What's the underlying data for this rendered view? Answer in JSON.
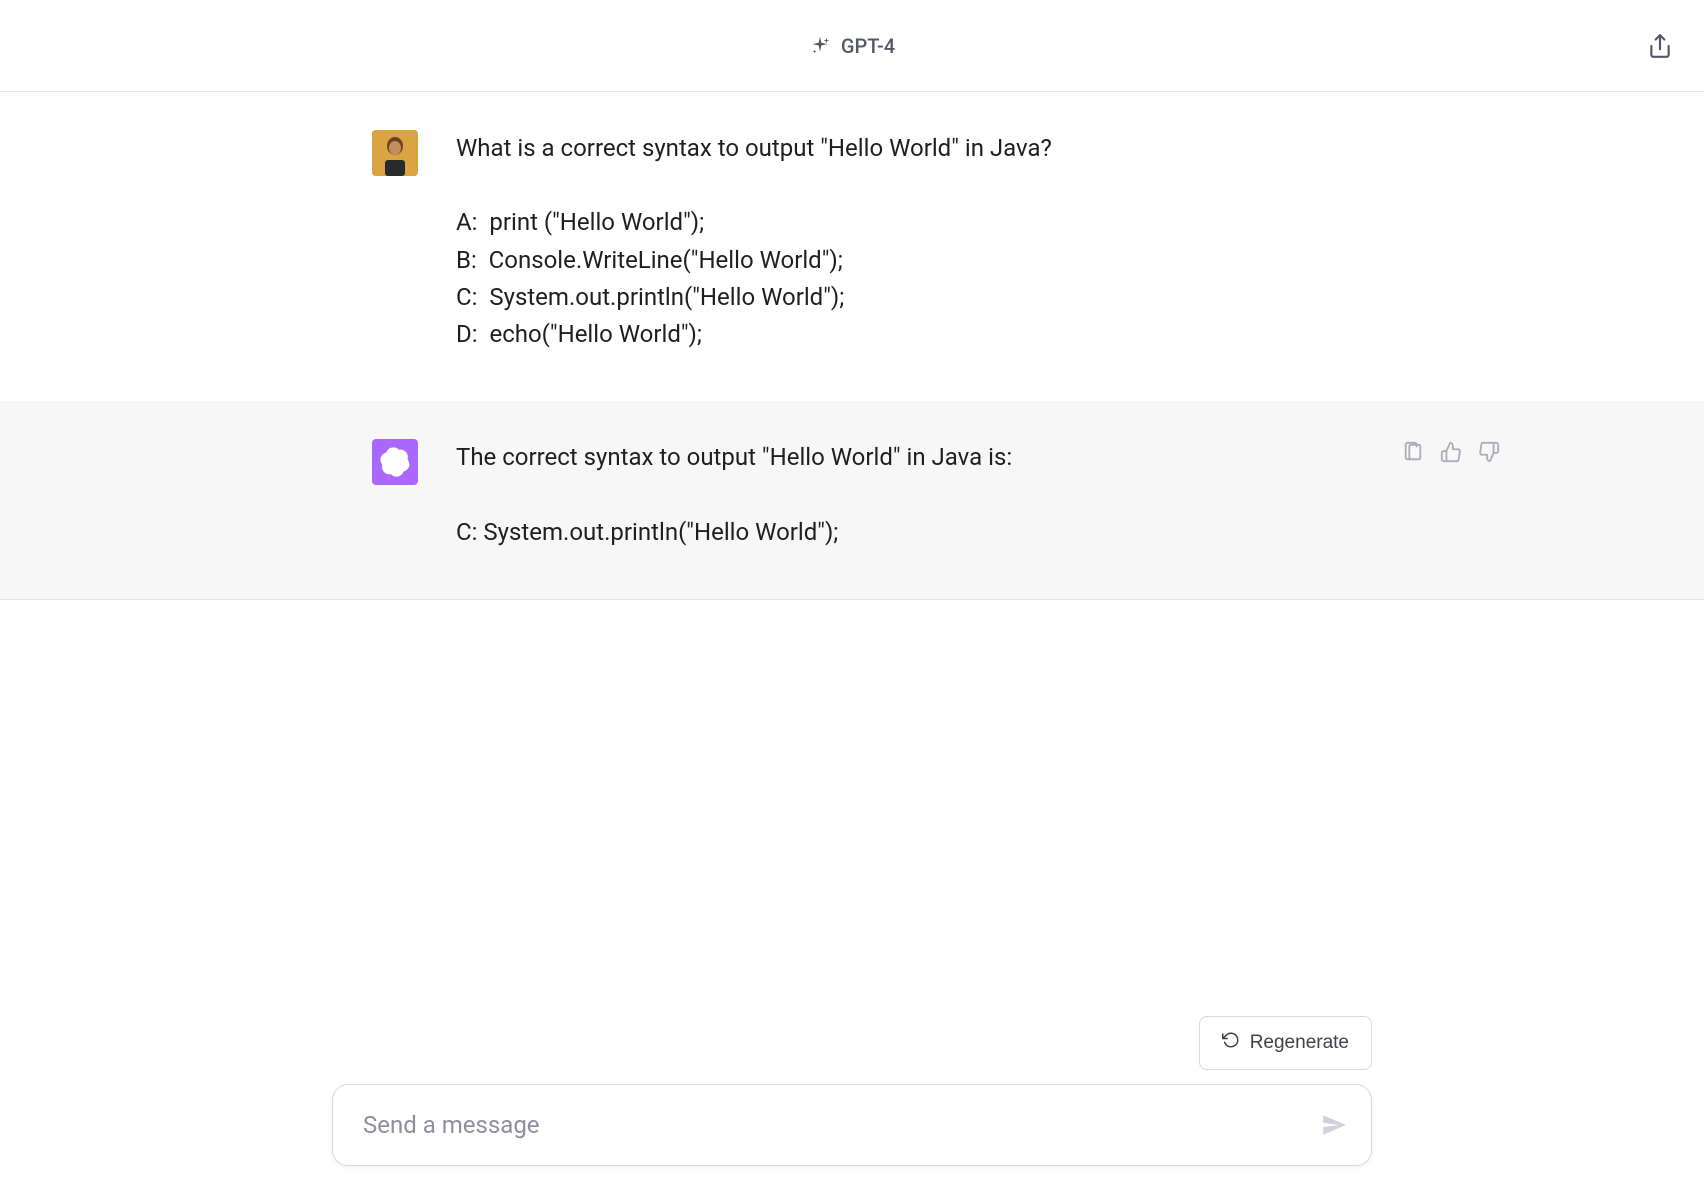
{
  "header": {
    "model_name": "GPT-4"
  },
  "messages": {
    "user": {
      "text": "What is a correct syntax to output \"Hello World\" in Java?\n\nA:  print (\"Hello World\");\nB:  Console.WriteLine(\"Hello World\");\nC:  System.out.println(\"Hello World\");\nD:  echo(\"Hello World\");"
    },
    "assistant": {
      "text": "The correct syntax to output \"Hello World\" in Java is:\n\nC: System.out.println(\"Hello World\");"
    }
  },
  "actions": {
    "regenerate_label": "Regenerate"
  },
  "input": {
    "placeholder": "Send a message"
  }
}
